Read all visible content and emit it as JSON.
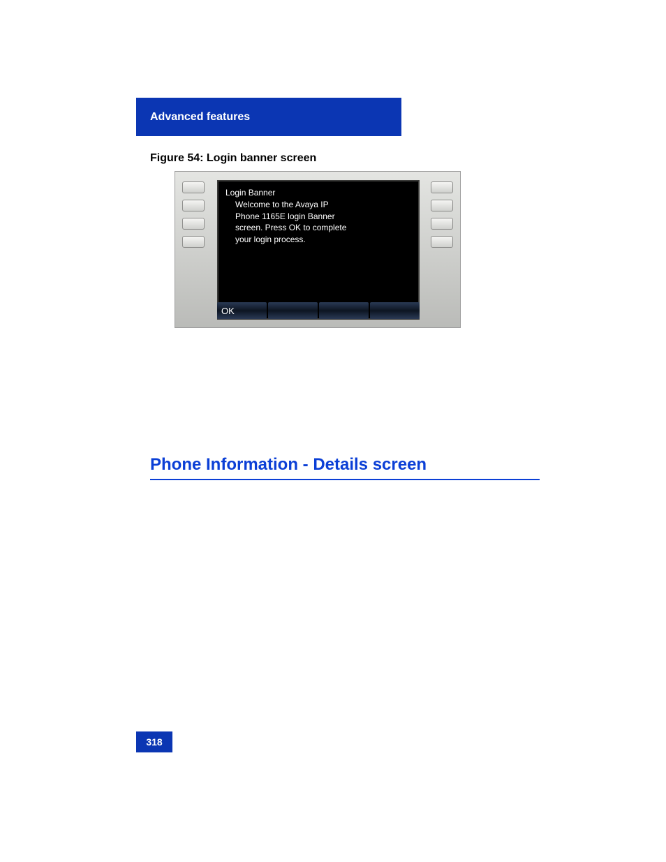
{
  "header": {
    "title": "Advanced features"
  },
  "figure": {
    "caption": "Figure 54: Login banner screen"
  },
  "phone": {
    "banner_title": "Login Banner",
    "banner_line1": "Welcome to the Avaya IP",
    "banner_line2": "Phone 1165E login Banner",
    "banner_line3": "screen. Press OK to complete",
    "banner_line4": "your login process.",
    "softkey1": "OK",
    "softkey2": "",
    "softkey3": "",
    "softkey4": ""
  },
  "section": {
    "heading": "Phone Information - Details screen"
  },
  "page": {
    "number": "318"
  }
}
